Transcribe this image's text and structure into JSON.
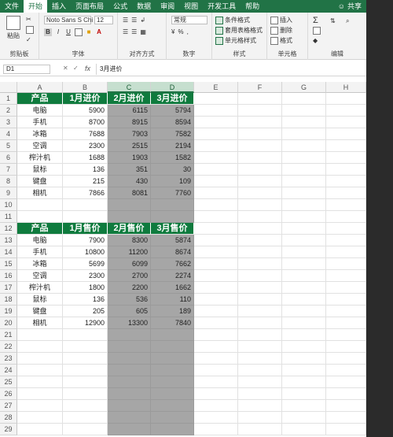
{
  "ribbon": {
    "tabs": [
      "文件",
      "开始",
      "插入",
      "页面布局",
      "公式",
      "数据",
      "审阅",
      "视图",
      "开发工具",
      "帮助"
    ],
    "active_tab": "开始",
    "share": "共享",
    "paste": "粘贴",
    "font_name": "Noto Sans S Chi",
    "font_size": "12",
    "number_format": "常规",
    "conditional_format": "条件格式",
    "table_format": "套用表格格式",
    "cell_style": "单元格样式",
    "insert": "插入",
    "delete": "删除",
    "format": "格式",
    "groups": [
      "剪贴板",
      "字体",
      "对齐方式",
      "数字",
      "样式",
      "单元格",
      "编辑"
    ]
  },
  "formula_bar": {
    "name_box": "D1",
    "fx": "fx",
    "cancel": "✕",
    "enter": "✓",
    "value": "3月进价"
  },
  "sheet": {
    "columns": [
      "A",
      "B",
      "C",
      "D",
      "E",
      "F",
      "G",
      "H"
    ],
    "selected_columns": [
      "C",
      "D"
    ],
    "rows": [
      {
        "n": "1",
        "cells": [
          "产品",
          "1月进价",
          "2月进价",
          "3月进价"
        ],
        "header": true
      },
      {
        "n": "2",
        "cells": [
          "电脑",
          "5900",
          "6115",
          "5794"
        ]
      },
      {
        "n": "3",
        "cells": [
          "手机",
          "8700",
          "8915",
          "8594"
        ]
      },
      {
        "n": "4",
        "cells": [
          "冰箱",
          "7688",
          "7903",
          "7582"
        ]
      },
      {
        "n": "5",
        "cells": [
          "空调",
          "2300",
          "2515",
          "2194"
        ]
      },
      {
        "n": "6",
        "cells": [
          "榨汁机",
          "1688",
          "1903",
          "1582"
        ]
      },
      {
        "n": "7",
        "cells": [
          "鼠标",
          "136",
          "351",
          "30"
        ]
      },
      {
        "n": "8",
        "cells": [
          "键盘",
          "215",
          "430",
          "109"
        ]
      },
      {
        "n": "9",
        "cells": [
          "相机",
          "7866",
          "8081",
          "7760"
        ]
      },
      {
        "n": "10",
        "cells": [
          "",
          "",
          "",
          ""
        ]
      },
      {
        "n": "11",
        "cells": [
          "",
          "",
          "",
          ""
        ]
      },
      {
        "n": "12",
        "cells": [
          "产品",
          "1月售价",
          "2月售价",
          "3月售价"
        ],
        "header": true
      },
      {
        "n": "13",
        "cells": [
          "电脑",
          "7900",
          "8300",
          "5874"
        ]
      },
      {
        "n": "14",
        "cells": [
          "手机",
          "10800",
          "11200",
          "8674"
        ]
      },
      {
        "n": "15",
        "cells": [
          "冰箱",
          "5699",
          "6099",
          "7662"
        ]
      },
      {
        "n": "16",
        "cells": [
          "空调",
          "2300",
          "2700",
          "2274"
        ]
      },
      {
        "n": "17",
        "cells": [
          "榨汁机",
          "1800",
          "2200",
          "1662"
        ]
      },
      {
        "n": "18",
        "cells": [
          "鼠标",
          "136",
          "536",
          "110"
        ]
      },
      {
        "n": "19",
        "cells": [
          "键盘",
          "205",
          "605",
          "189"
        ]
      },
      {
        "n": "20",
        "cells": [
          "相机",
          "12900",
          "13300",
          "7840"
        ]
      },
      {
        "n": "21",
        "cells": [
          "",
          "",
          "",
          ""
        ]
      },
      {
        "n": "22",
        "cells": [
          "",
          "",
          "",
          ""
        ]
      },
      {
        "n": "23",
        "cells": [
          "",
          "",
          "",
          ""
        ]
      },
      {
        "n": "24",
        "cells": [
          "",
          "",
          "",
          ""
        ]
      },
      {
        "n": "25",
        "cells": [
          "",
          "",
          "",
          ""
        ]
      },
      {
        "n": "26",
        "cells": [
          "",
          "",
          "",
          ""
        ]
      },
      {
        "n": "27",
        "cells": [
          "",
          "",
          "",
          ""
        ]
      },
      {
        "n": "28",
        "cells": [
          "",
          "",
          "",
          ""
        ]
      },
      {
        "n": "29",
        "cells": [
          "",
          "",
          "",
          ""
        ]
      }
    ]
  },
  "watermark": "php中文网",
  "colors": {
    "accent": "#217346",
    "header_fill": "#0f7b3e",
    "selection_fill": "#a6a6a6"
  }
}
